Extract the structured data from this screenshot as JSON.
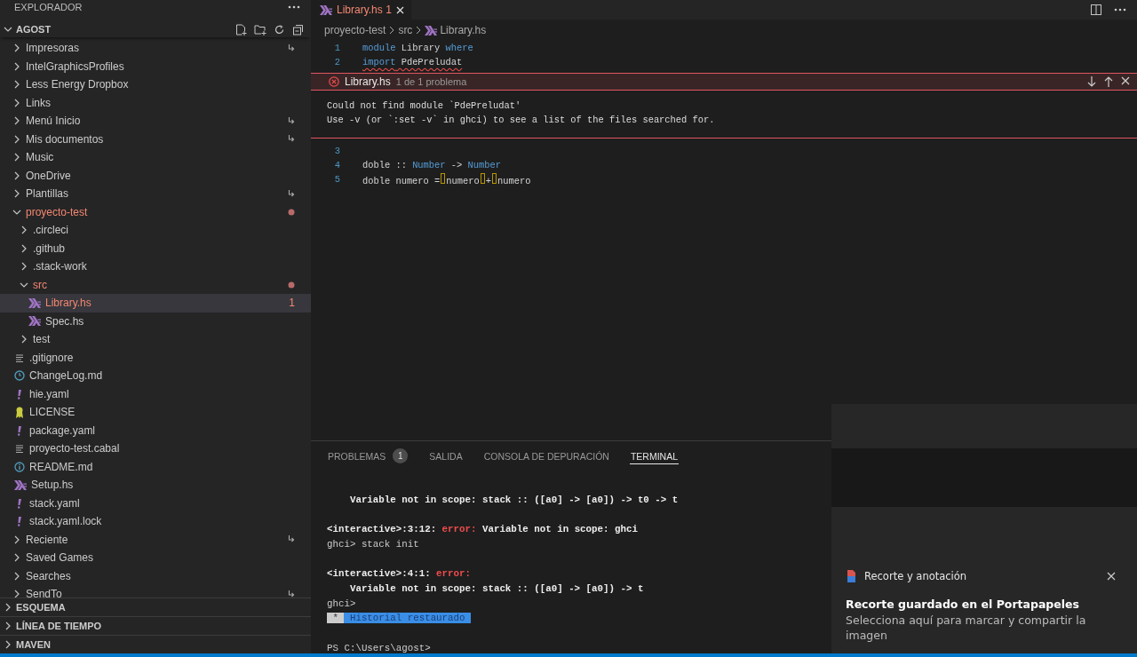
{
  "sidebar": {
    "title": "EXPLORADOR",
    "root": {
      "label": "AGOST",
      "expanded": true
    },
    "tree": [
      {
        "label": "Impresoras",
        "kind": "folder",
        "expanded": false,
        "link": true,
        "selected": false
      },
      {
        "label": "IntelGraphicsProfiles",
        "kind": "folder",
        "expanded": false,
        "selected": false
      },
      {
        "label": "Less Energy Dropbox",
        "kind": "folder",
        "expanded": false,
        "selected": false
      },
      {
        "label": "Links",
        "kind": "folder",
        "expanded": false,
        "selected": false
      },
      {
        "label": "Menú Inicio",
        "kind": "folder",
        "expanded": false,
        "link": true,
        "selected": false
      },
      {
        "label": "Mis documentos",
        "kind": "folder",
        "expanded": false,
        "link": true,
        "selected": false
      },
      {
        "label": "Music",
        "kind": "folder",
        "expanded": false,
        "selected": false
      },
      {
        "label": "OneDrive",
        "kind": "folder",
        "expanded": false,
        "selected": false
      },
      {
        "label": "Plantillas",
        "kind": "folder",
        "expanded": false,
        "link": true,
        "selected": false
      },
      {
        "label": "proyecto-test",
        "kind": "folder",
        "expanded": true,
        "error": true,
        "modified": true,
        "selected": false,
        "children": [
          {
            "label": ".circleci",
            "kind": "folder",
            "expanded": false,
            "selected": false
          },
          {
            "label": ".github",
            "kind": "folder",
            "expanded": false,
            "selected": false
          },
          {
            "label": ".stack-work",
            "kind": "folder",
            "expanded": false,
            "selected": false
          },
          {
            "label": "src",
            "kind": "folder",
            "expanded": true,
            "error": true,
            "modified": true,
            "selected": false,
            "children": [
              {
                "label": "Library.hs",
                "kind": "haskell",
                "error": true,
                "badge": "1",
                "selected": true
              },
              {
                "label": "Spec.hs",
                "kind": "haskell",
                "selected": false
              }
            ]
          },
          {
            "label": "test",
            "kind": "folder",
            "expanded": false,
            "selected": false
          },
          {
            "label": ".gitignore",
            "kind": "lines",
            "selected": false
          },
          {
            "label": "ChangeLog.md",
            "kind": "changelog",
            "selected": false
          },
          {
            "label": "hie.yaml",
            "kind": "yaml",
            "selected": false
          },
          {
            "label": "LICENSE",
            "kind": "license",
            "selected": false
          },
          {
            "label": "package.yaml",
            "kind": "yaml",
            "selected": false
          },
          {
            "label": "proyecto-test.cabal",
            "kind": "lines",
            "selected": false
          },
          {
            "label": "README.md",
            "kind": "readme",
            "selected": false
          },
          {
            "label": "Setup.hs",
            "kind": "haskell",
            "selected": false
          },
          {
            "label": "stack.yaml",
            "kind": "yaml",
            "selected": false
          },
          {
            "label": "stack.yaml.lock",
            "kind": "yaml",
            "selected": false
          }
        ]
      },
      {
        "label": "Reciente",
        "kind": "folder",
        "expanded": false,
        "link": true,
        "selected": false
      },
      {
        "label": "Saved Games",
        "kind": "folder",
        "expanded": false,
        "selected": false
      },
      {
        "label": "Searches",
        "kind": "folder",
        "expanded": false,
        "selected": false
      },
      {
        "label": "SendTo",
        "kind": "folder",
        "expanded": false,
        "link": true,
        "selected": false
      }
    ],
    "sections": [
      {
        "label": "ESQUEMA",
        "expanded": false
      },
      {
        "label": "LÍNEA DE TIEMPO",
        "expanded": false
      },
      {
        "label": "MAVEN",
        "expanded": false
      }
    ]
  },
  "editor": {
    "tabs": [
      {
        "label": "Library.hs",
        "badge": "1",
        "error": true,
        "selected": true
      }
    ],
    "breadcrumb": [
      {
        "label": "proyecto-test",
        "kind": "folder"
      },
      {
        "label": "src",
        "kind": "folder"
      },
      {
        "label": "Library.hs",
        "kind": "haskell"
      }
    ],
    "lines_before": [
      {
        "number": "1",
        "tokens": [
          {
            "text": "module",
            "kind": "keyword"
          },
          {
            "text": " Library ",
            "kind": "plain"
          },
          {
            "text": "where",
            "kind": "keyword"
          }
        ]
      },
      {
        "number": "2",
        "tokens": [
          {
            "text": "import",
            "kind": "keyword",
            "squiggle": true
          },
          {
            "text": " PdePreludat",
            "kind": "plain",
            "squiggle": true
          }
        ]
      }
    ],
    "peek": {
      "file": "Library.hs",
      "summary": "1 de 1 problema",
      "message_lines": [
        "Could not find module `PdePreludat'",
        "Use -v (or `:set -v` in ghci) to see a list of the files searched for."
      ]
    },
    "lines_after": [
      {
        "number": "3"
      },
      {
        "number": "4",
        "tokens": [
          {
            "text": "doble :: ",
            "kind": "plain"
          },
          {
            "text": "Number",
            "kind": "type"
          },
          {
            "text": " -> ",
            "kind": "plain"
          },
          {
            "text": "Number",
            "kind": "type"
          }
        ]
      },
      {
        "number": "5",
        "tokens": [
          {
            "text": "doble numero =",
            "kind": "plain"
          },
          {
            "text": "numero",
            "kind": "plain",
            "space_marked": true
          },
          {
            "text": "+",
            "kind": "plain",
            "space_marked": true
          },
          {
            "text": "numero",
            "kind": "plain",
            "space_marked": true
          }
        ]
      }
    ]
  },
  "panel": {
    "tabs": [
      {
        "label": "PROBLEMAS",
        "badge": "1",
        "selected": false
      },
      {
        "label": "SALIDA",
        "selected": false
      },
      {
        "label": "CONSOLA DE DEPURACIÓN",
        "selected": false
      },
      {
        "label": "TERMINAL",
        "selected": true
      }
    ],
    "terminal": [
      {
        "kind": "blank"
      },
      {
        "kind": "text",
        "segments": [
          {
            "text": "    Variable not in scope: stack :: ([a0] -> [a0]) -> t0 -> t",
            "kind": "bold"
          }
        ]
      },
      {
        "kind": "blank"
      },
      {
        "kind": "text",
        "segments": [
          {
            "text": "<interactive>:3:12: ",
            "kind": "bold"
          },
          {
            "text": "error:",
            "kind": "error"
          },
          {
            "text": " Variable not in scope: ghci",
            "kind": "bold"
          }
        ]
      },
      {
        "kind": "text",
        "segments": [
          {
            "text": "ghci> stack init",
            "kind": "plain"
          }
        ]
      },
      {
        "kind": "blank"
      },
      {
        "kind": "text",
        "segments": [
          {
            "text": "<interactive>:4:1: ",
            "kind": "bold"
          },
          {
            "text": "error:",
            "kind": "error"
          }
        ]
      },
      {
        "kind": "text",
        "segments": [
          {
            "text": "    Variable not in scope: stack :: ([a0] -> [a0]) -> t",
            "kind": "bold"
          }
        ]
      },
      {
        "kind": "text",
        "segments": [
          {
            "text": "ghci>",
            "kind": "plain"
          }
        ]
      },
      {
        "kind": "text",
        "segments": [
          {
            "text": " * ",
            "kind": "marker"
          },
          {
            "text": " Historial restaurado ",
            "kind": "highlight"
          }
        ]
      },
      {
        "kind": "blank"
      },
      {
        "kind": "text",
        "segments": [
          {
            "text": "PS C:\\Users\\agost>",
            "kind": "plain"
          }
        ]
      }
    ]
  },
  "notification": {
    "app": "Recorte y anotación",
    "title": "Recorte guardado en el Portapapeles",
    "body": "Selecciona aquí para marcar y compartir la imagen"
  }
}
